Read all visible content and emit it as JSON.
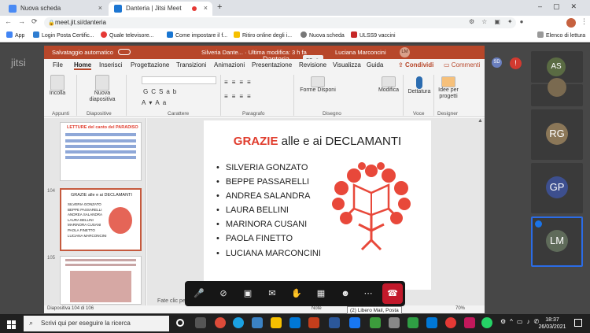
{
  "browser": {
    "tabs": [
      {
        "label": "Nuova scheda",
        "close": "×"
      },
      {
        "label": "Danteria | Jitsi Meet",
        "close": "×"
      }
    ],
    "new_tab": "+",
    "url": "meet.jit.si/danteria",
    "bookmarks": [
      "App",
      "Login Posta Certific...",
      "Quale televisore...",
      "Come impostare il f...",
      "Ritiro online degli i...",
      "Nuova scheda",
      "ULSS9 vaccini"
    ],
    "reading_list": "Elenco di lettura"
  },
  "jitsi": {
    "logo": "jitsi",
    "room_name": "Danteria",
    "participant_count": "22",
    "participants": [
      {
        "initials": "AS",
        "color": "#5a6b43"
      },
      {
        "initials": "",
        "color": "#7a6a50"
      },
      {
        "initials": "RG",
        "color": "#8b7758"
      },
      {
        "initials": "GP",
        "color": "#3d4f8e"
      },
      {
        "initials": "LM",
        "color": "#5f6b5a"
      }
    ],
    "top_avatar_sd": "SD",
    "tooltip": "(2) Libero Mail, Posta"
  },
  "ppt": {
    "title_bar": {
      "autosave": "Salvataggio automatico",
      "doc": "Silveria Dante... · Ultima modifica: 3 h fa",
      "user": "Luciana Marconcini",
      "user_initials": "LM"
    },
    "tabs": [
      "File",
      "Home",
      "Inserisci",
      "Progettazione",
      "Transizioni",
      "Animazioni",
      "Presentazione",
      "Revisione",
      "Visualizza",
      "Guida"
    ],
    "share": "Condividi",
    "comments": "Commenti",
    "ribbon": {
      "incolla": "Incolla",
      "nuova_diapositiva": "Nuova diapositiva",
      "forme": "Forme",
      "disponi": "Disponi",
      "modifica": "Modifica",
      "dettatura": "Dettatura",
      "idee": "Idee per progetti",
      "groups": [
        "Appunti",
        "Diapositive",
        "Carattere",
        "Paragrafo",
        "Disegno",
        "Voce",
        "Designer"
      ]
    },
    "thumbs": {
      "slide1_title": "LETTURE del canto del PARADISO",
      "slide2_no": "104",
      "slide2_title": "GRAZIE alle e ai DECLAMANTI",
      "slide2_items": [
        "SILVERIA GONZATO",
        "BEPPE PASSARELLI",
        "ANDREA SALANDRA",
        "LAURA BELLINI",
        "MARINORA CUSANI",
        "PAOLA FINETTO",
        "LUCIANA MARCONCINI"
      ],
      "slide3_no": "105"
    },
    "slide": {
      "title_red": "GRAZIE",
      "title_rest": " alle e ai DECLAMANTI",
      "items": [
        "SILVERIA GONZATO",
        "BEPPE PASSARELLI",
        "ANDREA SALANDRA",
        "LAURA BELLINI",
        "MARINORA CUSANI",
        "PAOLA FINETTO",
        "LUCIANA MARCONCINI"
      ]
    },
    "notes_placeholder": "Fate clic per",
    "status": {
      "slide_counter": "Diapositiva 104 di 106",
      "notes": "Note",
      "zoom": "70%"
    }
  },
  "taskbar": {
    "search_placeholder": "Scrivi qui per eseguire la ricerca",
    "time": "18:37",
    "date": "26/03/2021"
  },
  "colors": {
    "ppt_red": "#b7472a",
    "slide_title_red": "#e03c2d",
    "jitsi_bg": "#474747"
  }
}
